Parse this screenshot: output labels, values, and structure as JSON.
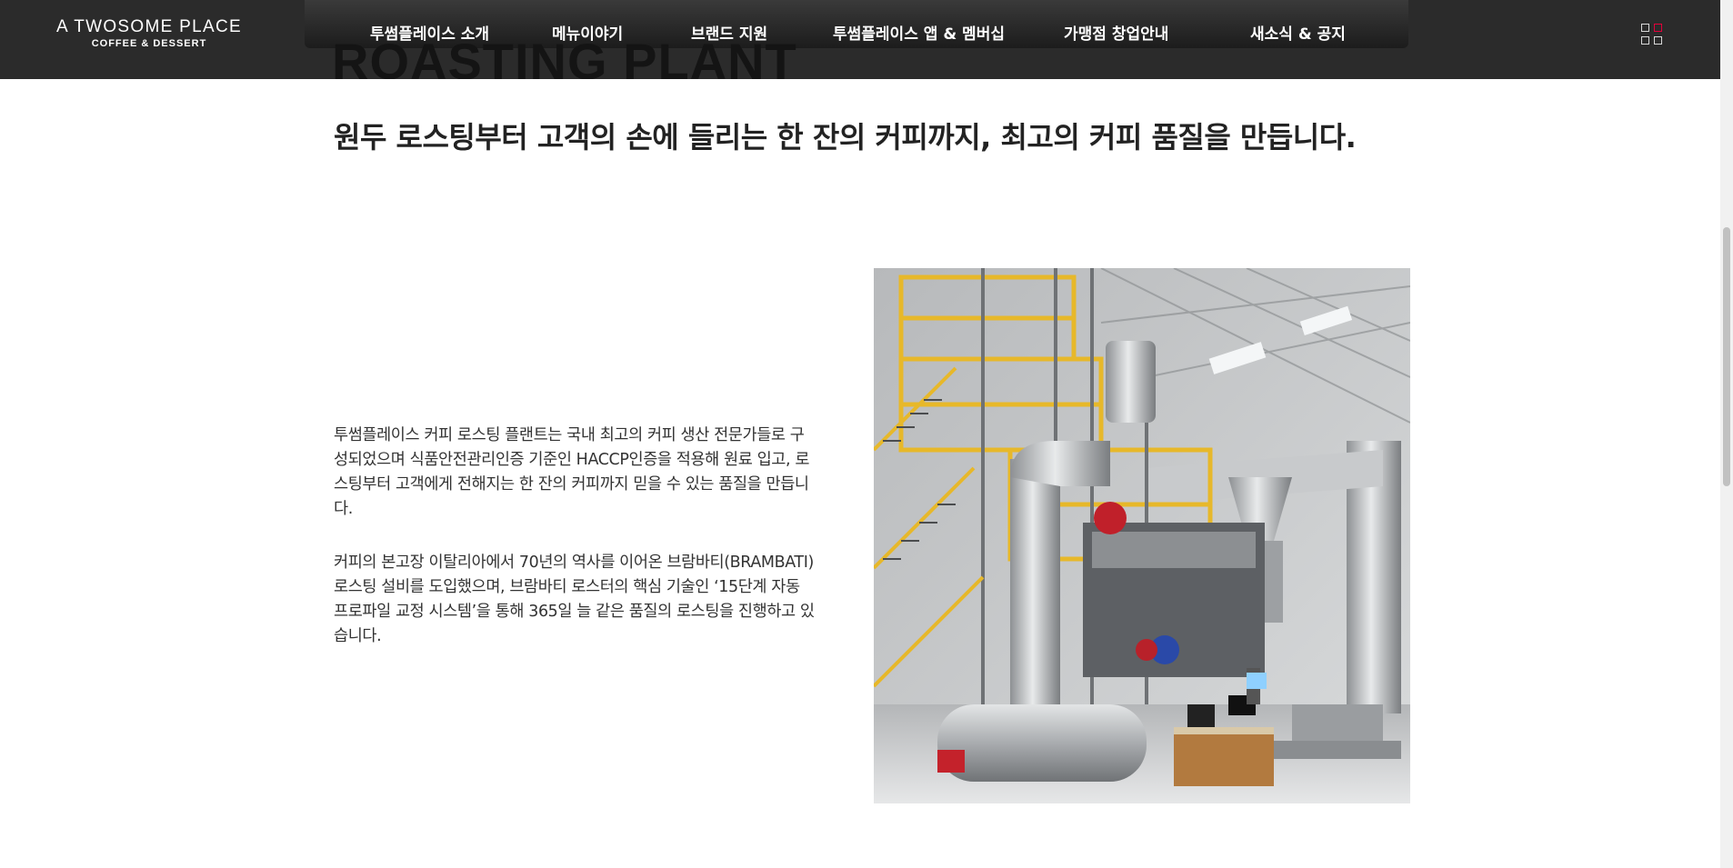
{
  "brand": {
    "name": "A TWOSOME PLACE",
    "tagline": "COFFEE & DESSERT"
  },
  "header": {
    "background_text": "ROASTING PLANT",
    "nav": [
      {
        "label": "투썸플레이스 소개"
      },
      {
        "label": "메뉴이야기"
      },
      {
        "label": "브랜드 지원"
      },
      {
        "label": "투썸플레이스 앱 & 멤버십"
      },
      {
        "label": "가맹점 창업안내"
      },
      {
        "label": "새소식 & 공지"
      }
    ],
    "menu_icon": "grid-menu-icon",
    "accent_color": "#e4003a"
  },
  "main": {
    "headline": "원두 로스팅부터 고객의 손에 들리는 한 잔의 커피까지, 최고의 커피 품질을 만듭니다.",
    "paragraph1": "투썸플레이스 커피 로스팅 플랜트는 국내 최고의 커피 생산 전문가들로 구성되었으며 식품안전관리인증 기준인 HACCP인증을 적용해 원료 입고, 로스팅부터 고객에게 전해지는 한 잔의 커피까지 믿을 수 있는 품질을 만듭니다.",
    "paragraph2": "커피의 본고장 이탈리아에서 70년의 역사를 이어온 브람바티(BRAMBATI) 로스팅 설비를 도입했으며, 브람바티 로스터의 핵심 기술인 ‘15단계 자동 프로파일 교정 시스템’을 통해 365일 늘 같은 품질의 로스팅을 진행하고 있습니다."
  }
}
